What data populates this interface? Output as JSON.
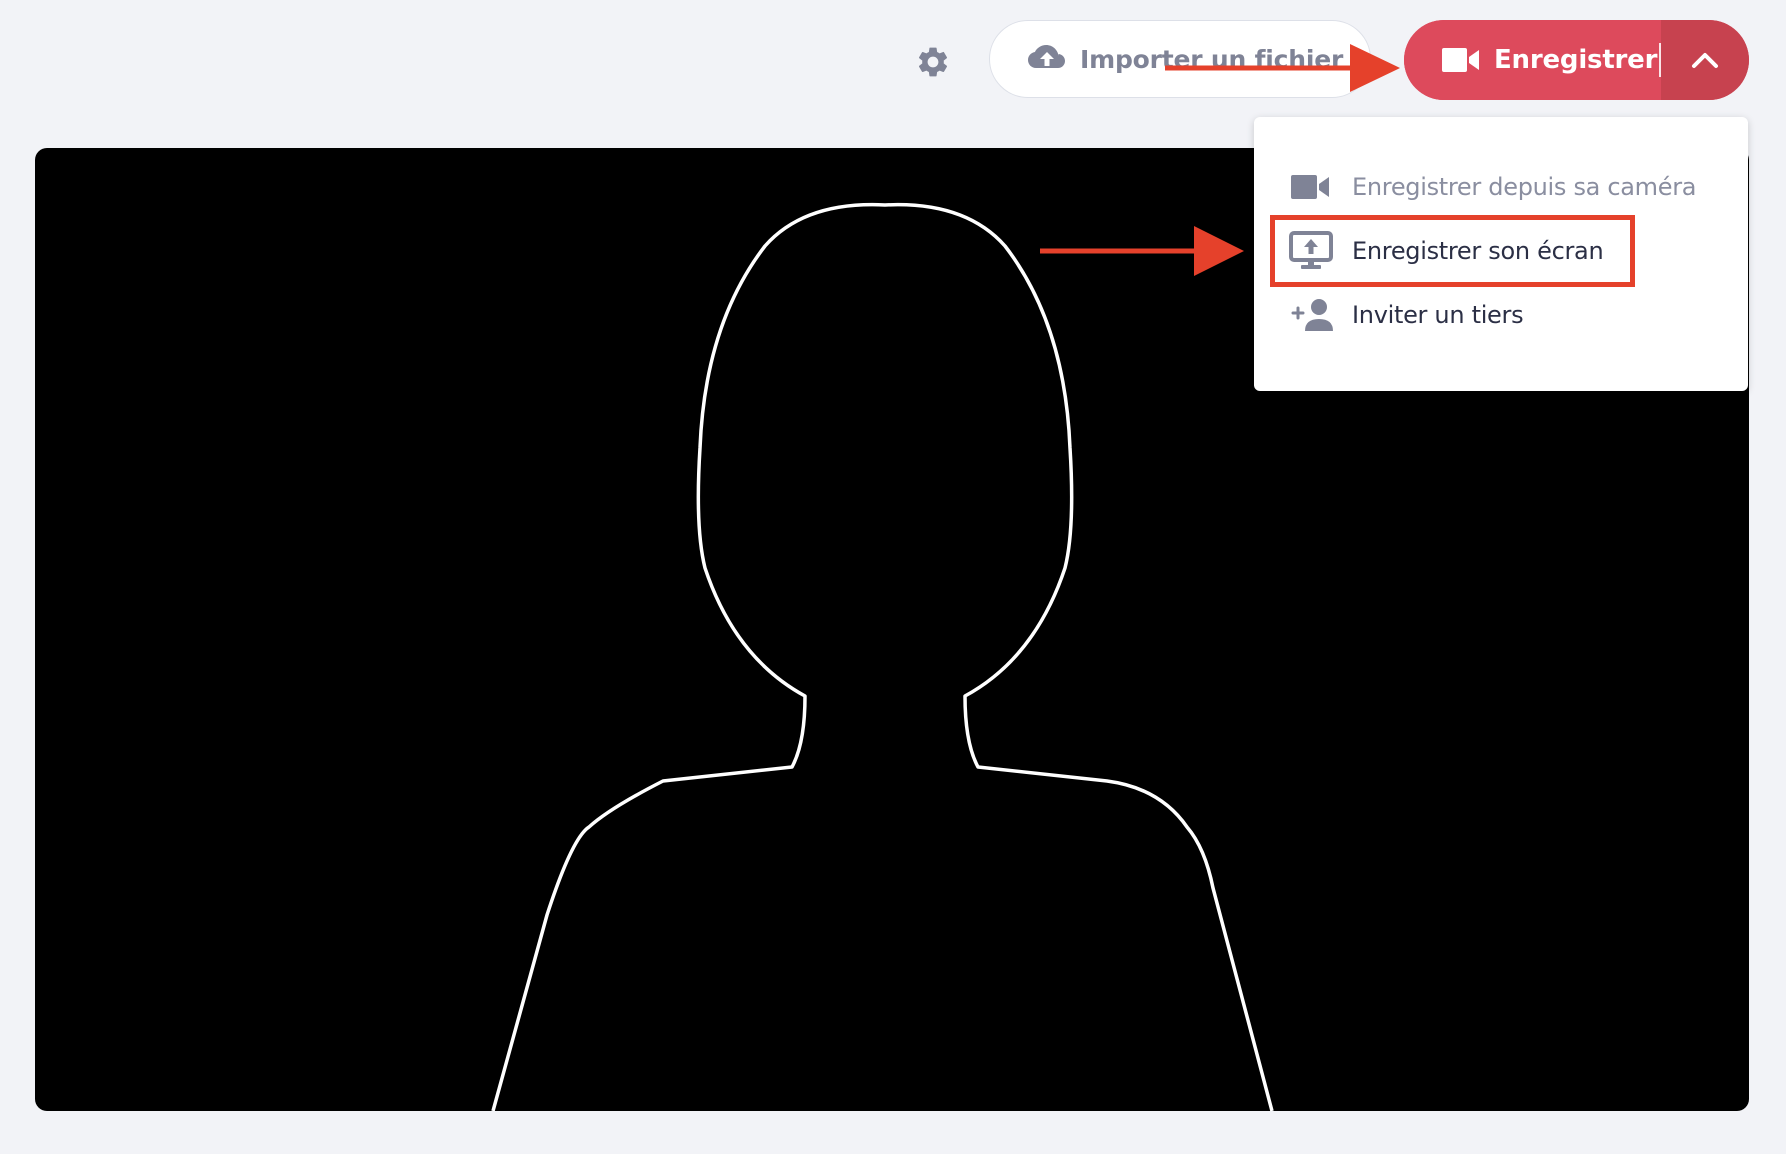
{
  "toolbar": {
    "settings_icon": "gear-icon",
    "import_icon": "cloud-upload-icon",
    "import_label": "Importer un fichier",
    "record_icon": "video-camera-icon",
    "record_label": "Enregistrer",
    "record_toggle_icon": "chevron-up-icon"
  },
  "menu": {
    "items": [
      {
        "icon": "video-camera-icon",
        "label": "Enregistrer depuis sa caméra",
        "state": "disabled"
      },
      {
        "icon": "screen-share-icon",
        "label": "Enregistrer son écran",
        "state": "highlighted"
      },
      {
        "icon": "add-person-icon",
        "label": "Inviter un tiers",
        "state": "normal"
      }
    ]
  },
  "colors": {
    "background": "#f2f3f7",
    "record_button": "#dd4a5c",
    "annotation_red": "#e5412b",
    "muted_icon": "#7f8396"
  }
}
